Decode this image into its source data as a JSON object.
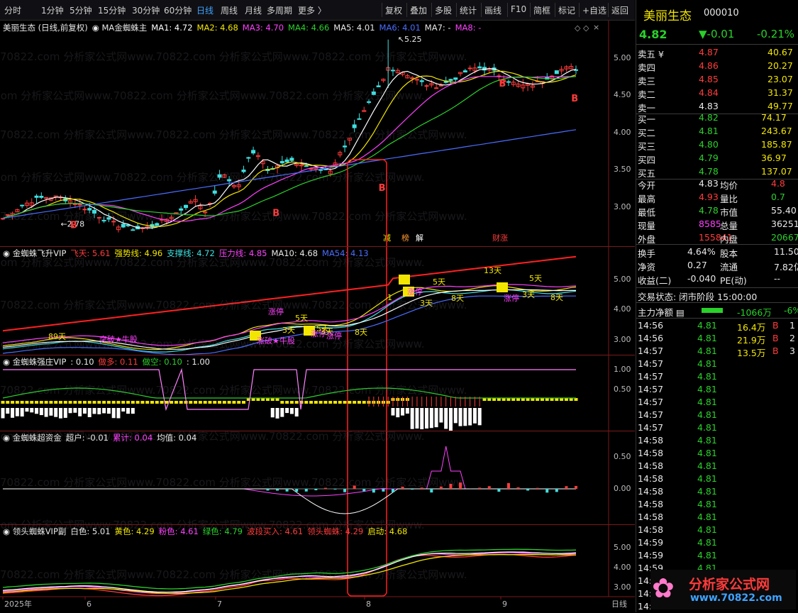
{
  "toolbar": {
    "left_items": [
      "分时",
      "1分钟",
      "5分钟",
      "15分钟",
      "30分钟",
      "60分钟",
      "日线",
      "周线",
      "月线",
      "多周期",
      "更多 〉"
    ],
    "active": "日线",
    "right_items": [
      "复权",
      "叠加",
      "多股",
      "统计",
      "画线",
      "F10",
      "简框",
      "标记",
      "+自选",
      "返回"
    ]
  },
  "main_panel": {
    "title": "美丽生态 (日线,前复权)",
    "indicator": "MA金蜘蛛主",
    "ma": [
      {
        "label": "MA1: 4.72",
        "color": "#ffffff"
      },
      {
        "label": "MA2: 4.68",
        "color": "#f2e600"
      },
      {
        "label": "MA3: 4.70",
        "color": "#ff40ff"
      },
      {
        "label": "MA4: 4.66",
        "color": "#2ad12a"
      },
      {
        "label": "MA5: 4.01",
        "color": "#e8e8e8"
      },
      {
        "label": "MA6: 4.01",
        "color": "#4a6dff"
      },
      {
        "label": "MA7: -",
        "color": "#e8e8e8"
      },
      {
        "label": "MA8: -",
        "color": "#ff40ff"
      }
    ],
    "axis": [
      "5.00",
      "4.50",
      "4.00",
      "3.50",
      "3.00"
    ],
    "annotations": {
      "high": "5.25",
      "low": "2.78"
    },
    "b_marks": [
      "B",
      "B",
      "B",
      "B",
      "B",
      "B"
    ],
    "event_tags": [
      "减",
      "榜",
      "解",
      "财涨"
    ]
  },
  "panel2": {
    "title": "金蜘蛛飞升VIP",
    "items": [
      {
        "label": "飞天: 5.61",
        "color": "#ff3b3b"
      },
      {
        "label": "强势线: 4.96",
        "color": "#f2e600"
      },
      {
        "label": "支撑线: 4.72",
        "color": "#3fe0e0"
      },
      {
        "label": "压力线: 4.85",
        "color": "#ff40ff"
      },
      {
        "label": "MA10: 4.68",
        "color": "#e8e8e8"
      },
      {
        "label": "MA54: 4.13",
        "color": "#4a6dff"
      }
    ],
    "axis": [
      "5.00",
      "4.00",
      "3.00"
    ],
    "labels": [
      "89天",
      "突破★牛股",
      "涨停",
      "5天",
      "3天",
      "涨停",
      "5天",
      "涨破★牛股",
      "3天",
      "涨停",
      "8天",
      "1",
      "涨停",
      "3天",
      "5天",
      "13天",
      "涨停",
      "8天",
      "3天",
      "5天",
      "8天"
    ]
  },
  "panel3": {
    "title": "金蜘蛛强庄VIP",
    "items": [
      {
        "label": ": 0.10",
        "color": "#e8e8e8"
      },
      {
        "label": "做多: 0.11",
        "color": "#ff3b3b"
      },
      {
        "label": "做空: 0.10",
        "color": "#2ad12a"
      },
      {
        "label": ": 1.00",
        "color": "#e8e8e8"
      }
    ],
    "axis": [
      "1.00",
      "0.50"
    ]
  },
  "panel4": {
    "title": "金蜘蛛超资金",
    "items": [
      {
        "label": "超户: -0.01",
        "color": "#e8e8e8"
      },
      {
        "label": "累计: 0.04",
        "color": "#ff40ff"
      },
      {
        "label": "均值: 0.04",
        "color": "#e8e8e8"
      }
    ],
    "axis": [
      "0.50",
      "0.00"
    ]
  },
  "panel5": {
    "title": "领头蜘蛛VIP副",
    "items": [
      {
        "label": "白色: 5.01",
        "color": "#e8e8e8"
      },
      {
        "label": "黄色: 4.29",
        "color": "#f2e600"
      },
      {
        "label": "粉色: 4.61",
        "color": "#ff40ff"
      },
      {
        "label": "绿色: 4.79",
        "color": "#2ad12a"
      },
      {
        "label": "波段买入: 4.61",
        "color": "#ff3b3b"
      },
      {
        "label": "领头蜘蛛: 4.29",
        "color": "#ff3b3b"
      },
      {
        "label": "启动: 4.68",
        "color": "#f2e600"
      }
    ],
    "axis": [
      "5.00",
      "4.00",
      "3.00"
    ]
  },
  "time_axis": [
    "2025年",
    "6",
    "7",
    "8",
    "9"
  ],
  "period_label": "日线",
  "watermark": "70822.com 分析家公式网www.70822.com 分析家公式网www.70822.com 分析家公式网www.",
  "quote": {
    "name": "美丽生态",
    "code": "000010",
    "price": "4.82",
    "change": "▼-0.01",
    "pct": "-0.21%",
    "asks": [
      {
        "label": "卖五 ¥",
        "price": "4.87",
        "vol": "40.67"
      },
      {
        "label": "卖四",
        "price": "4.86",
        "vol": "20.27"
      },
      {
        "label": "卖三",
        "price": "4.85",
        "vol": "23.07"
      },
      {
        "label": "卖二",
        "price": "4.84",
        "vol": "31.37"
      },
      {
        "label": "卖一",
        "price": "4.83",
        "vol": "49.77"
      }
    ],
    "bids": [
      {
        "label": "买一",
        "price": "4.82",
        "vol": "74.17"
      },
      {
        "label": "买二",
        "price": "4.81",
        "vol": "243.67"
      },
      {
        "label": "买三",
        "price": "4.80",
        "vol": "185.87"
      },
      {
        "label": "买四",
        "price": "4.79",
        "vol": "36.97"
      },
      {
        "label": "买五",
        "price": "4.78",
        "vol": "137.07"
      }
    ],
    "stats": [
      {
        "k1": "今开",
        "v1": "4.83",
        "c1": "#e8e8e8",
        "k2": "均价",
        "v2": "4.8",
        "c2": "#ff3b3b"
      },
      {
        "k1": "最高",
        "v1": "4.93",
        "c1": "#ff3b3b",
        "k2": "量比",
        "v2": "0.7",
        "c2": "#2ad12a"
      },
      {
        "k1": "最低",
        "v1": "4.78",
        "c1": "#2ad12a",
        "k2": "市值",
        "v2": "55.40",
        "c2": "#e8e8e8"
      },
      {
        "k1": "现量",
        "v1": "8585",
        "c1": "#ff40ff",
        "k2": "总量",
        "v2": "36251",
        "c2": "#e8e8e8"
      },
      {
        "k1": "外盘",
        "v1": "155841",
        "c1": "#ff3b3b",
        "k2": "内盘",
        "v2": "20667",
        "c2": "#2ad12a"
      }
    ],
    "stats2": [
      {
        "k1": "换手",
        "v1": "4.64%",
        "k2": "股本",
        "v2": "11.50"
      },
      {
        "k1": "净资",
        "v1": "0.27",
        "k2": "流通",
        "v2": "7.82亿"
      },
      {
        "k1": "收益(二)",
        "v1": "-0.040",
        "k2": "PE(动)",
        "v2": "--"
      }
    ],
    "status": "交易状态: 闭市阶段 15:00:00",
    "net_flow_label": "主力净额",
    "net_flow_value": "-1066万",
    "net_flow_pct": "-6%",
    "ticks": [
      {
        "t": "14:56",
        "p": "4.81",
        "v": "16.4万",
        "s": "B",
        "n": "1"
      },
      {
        "t": "14:56",
        "p": "4.81",
        "v": "21.9万",
        "s": "B",
        "n": "2"
      },
      {
        "t": "14:57",
        "p": "4.81",
        "v": "13.5万",
        "s": "B",
        "n": "3"
      },
      {
        "t": "14:57",
        "p": "4.81"
      },
      {
        "t": "14:57",
        "p": "4.81"
      },
      {
        "t": "14:57",
        "p": "4.81"
      },
      {
        "t": "14:57",
        "p": "4.81"
      },
      {
        "t": "14:57",
        "p": "4.81"
      },
      {
        "t": "14:57",
        "p": "4.81"
      },
      {
        "t": "14:58",
        "p": "4.81"
      },
      {
        "t": "14:58",
        "p": "4.81"
      },
      {
        "t": "14:58",
        "p": "4.81"
      },
      {
        "t": "14:58",
        "p": "4.81"
      },
      {
        "t": "14:58",
        "p": "4.81"
      },
      {
        "t": "14:58",
        "p": "4.81"
      },
      {
        "t": "14:58",
        "p": "4.81"
      },
      {
        "t": "14:58",
        "p": "4.81"
      },
      {
        "t": "14:59",
        "p": "4.81"
      },
      {
        "t": "14:59",
        "p": "4.81"
      },
      {
        "t": "14:59",
        "p": "4.81"
      },
      {
        "t": "14:59",
        "p": "4.81"
      },
      {
        "t": "14:59",
        "p": "4.81"
      },
      {
        "t": "14:59",
        "p": "4.81"
      }
    ],
    "logo_text": "分析家公式网",
    "logo_url": "www.70822.com"
  }
}
